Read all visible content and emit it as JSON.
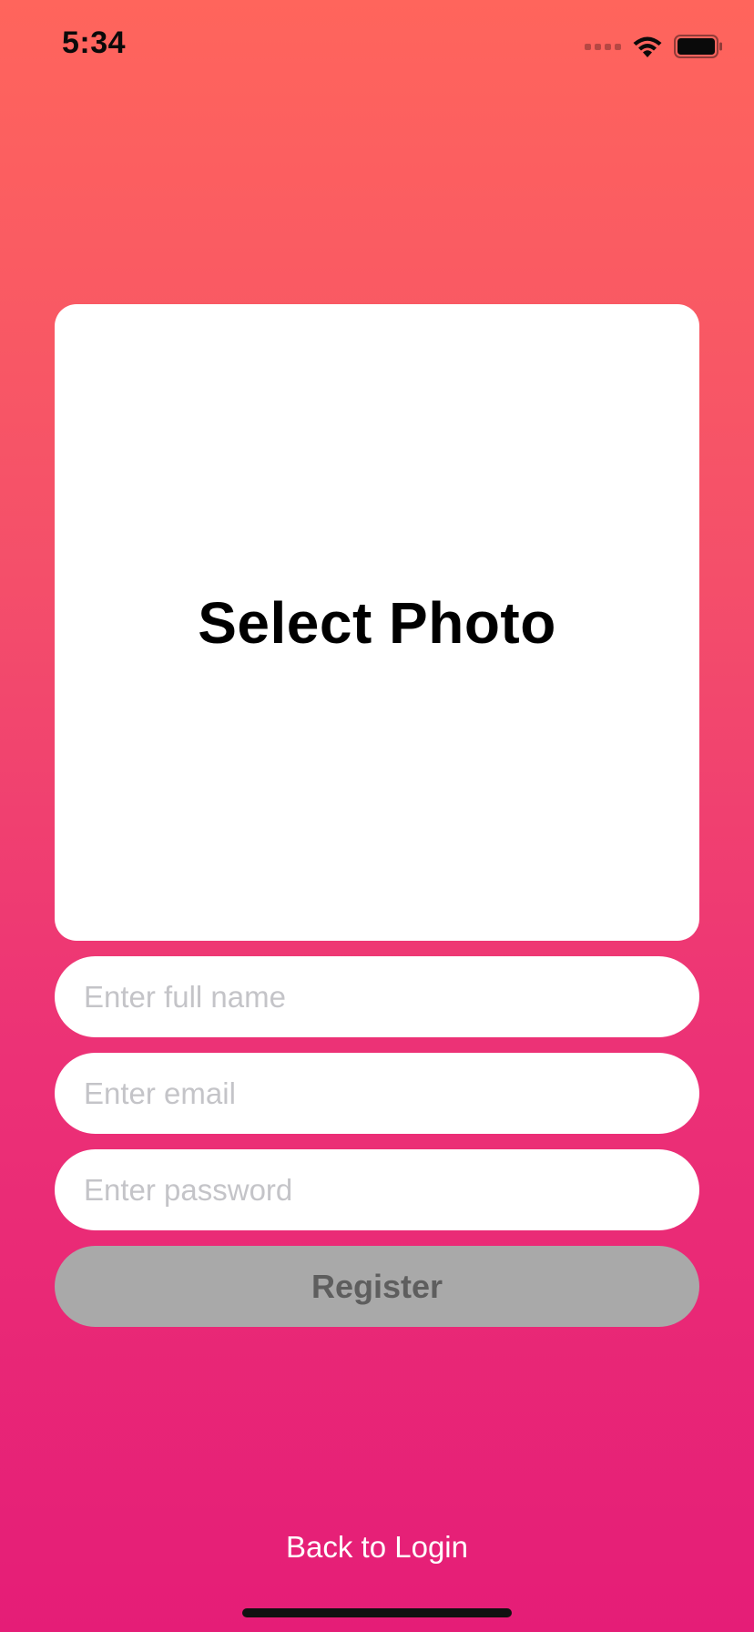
{
  "status_bar": {
    "time": "5:34",
    "icons": [
      "cellular-signal-icon",
      "wifi-icon",
      "battery-icon"
    ]
  },
  "photo_selector": {
    "label": "Select Photo"
  },
  "form": {
    "full_name": {
      "placeholder": "Enter full name",
      "value": ""
    },
    "email": {
      "placeholder": "Enter email",
      "value": ""
    },
    "password": {
      "placeholder": "Enter password",
      "value": ""
    },
    "register_label": "Register"
  },
  "footer": {
    "back_to_login_label": "Back to Login"
  },
  "colors": {
    "gradient_top": "#FF655C",
    "gradient_bottom": "#E51D77",
    "register_disabled_bg": "#A9A9A9",
    "register_disabled_text": "#5E5E5E",
    "placeholder": "#C4C4C8"
  }
}
